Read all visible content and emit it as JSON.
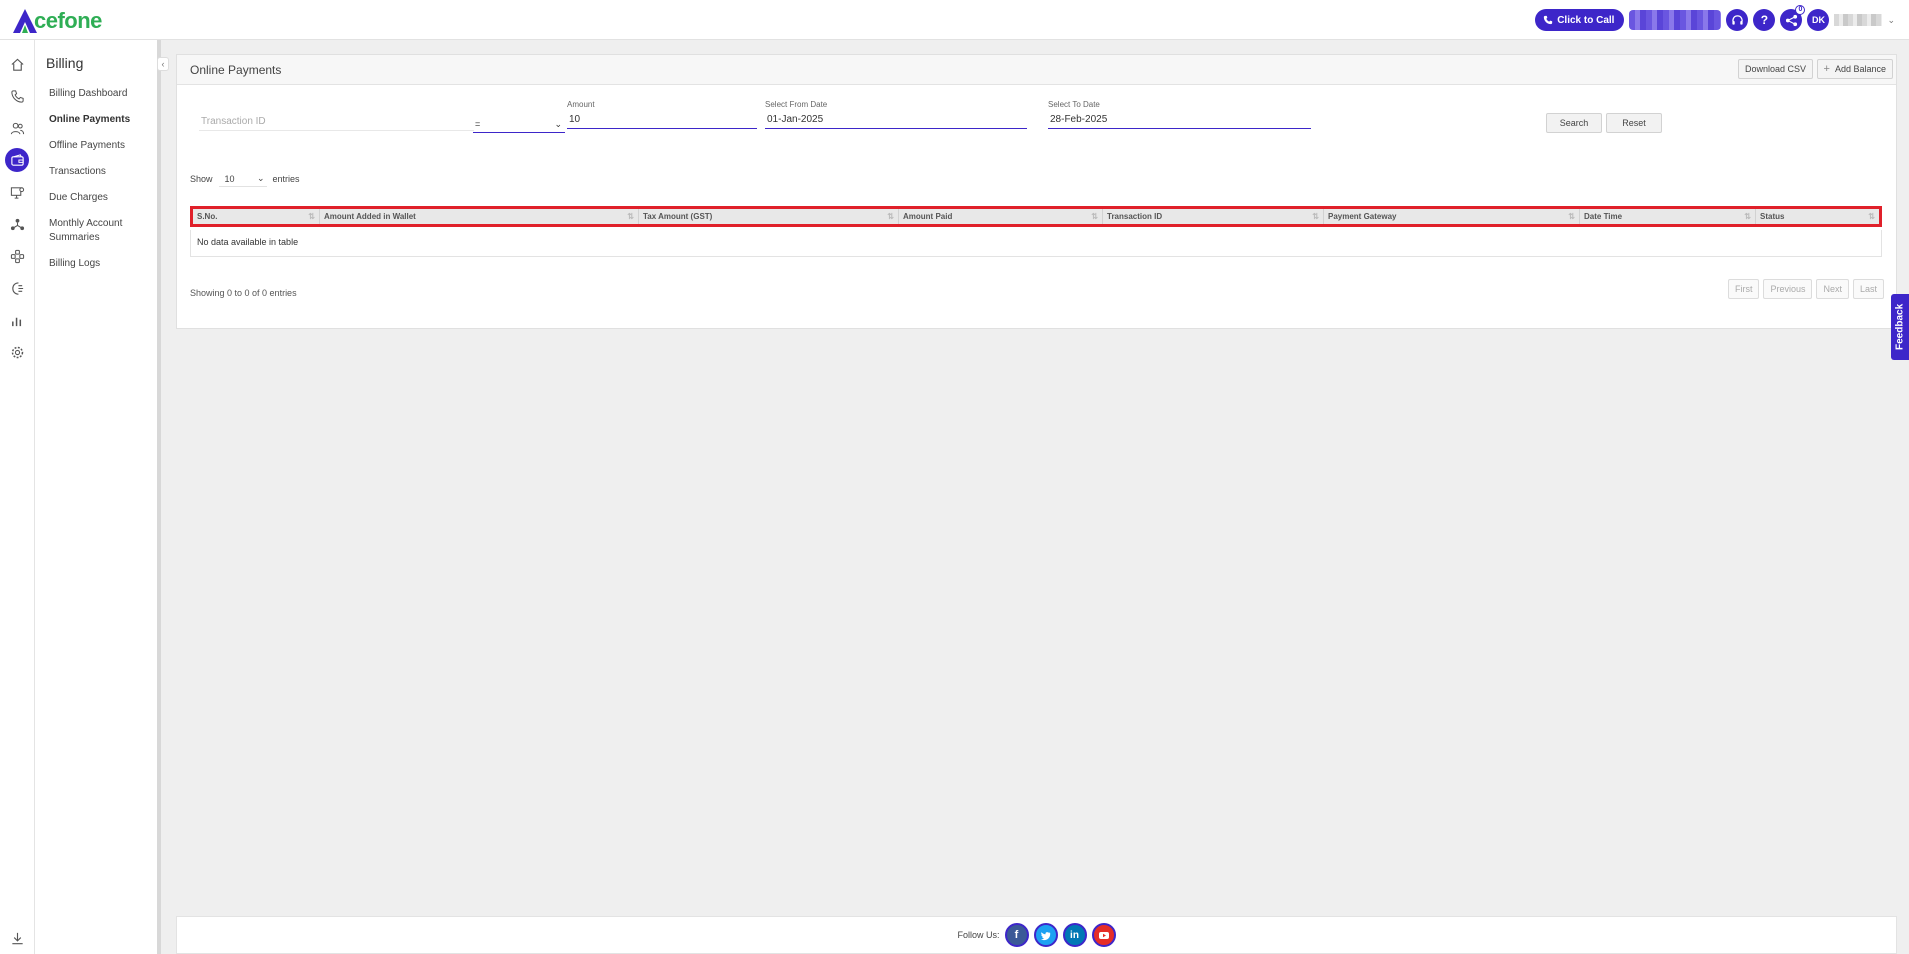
{
  "brand": {
    "name": "cefone",
    "accent": "#3d26c9",
    "green": "#2fae55"
  },
  "header": {
    "click_to_call": "Click to Call",
    "help_glyph": "?",
    "notification_count": "0",
    "avatar_initials": "DK"
  },
  "rail": [
    "home-icon",
    "phone-icon",
    "users-icon",
    "wallet-icon",
    "monitor-user-icon",
    "network-icon",
    "integrations-icon",
    "call-flow-icon",
    "reports-icon",
    "settings-icon",
    "download-icon"
  ],
  "subnav": {
    "title": "Billing",
    "items": [
      "Billing Dashboard",
      "Online Payments",
      "Offline Payments",
      "Transactions",
      "Due Charges",
      "Monthly Account Summaries",
      "Billing Logs"
    ]
  },
  "page": {
    "title": "Online Payments",
    "download_csv": "Download CSV",
    "add_balance": "Add Balance"
  },
  "filters": {
    "transaction_id_placeholder": "Transaction ID",
    "operator": "=",
    "amount_label": "Amount",
    "amount_value": "10",
    "from_label": "Select From Date",
    "from_value": "01-Jan-2025",
    "to_label": "Select To Date",
    "to_value": "28-Feb-2025",
    "search": "Search",
    "reset": "Reset"
  },
  "length": {
    "show": "Show",
    "value": "10",
    "entries": "entries"
  },
  "table": {
    "columns": [
      "S.No.",
      "Amount Added in Wallet",
      "Tax Amount (GST)",
      "Amount Paid",
      "Transaction ID",
      "Payment Gateway",
      "Date Time",
      "Status"
    ],
    "empty": "No data available in table"
  },
  "pagination": {
    "info": "Showing 0 to 0 of 0 entries",
    "first": "First",
    "previous": "Previous",
    "next": "Next",
    "last": "Last"
  },
  "feedback": "Feedback",
  "footer": {
    "follow": "Follow Us:",
    "social": [
      "facebook-icon",
      "twitter-icon",
      "linkedin-icon",
      "youtube-icon"
    ]
  }
}
